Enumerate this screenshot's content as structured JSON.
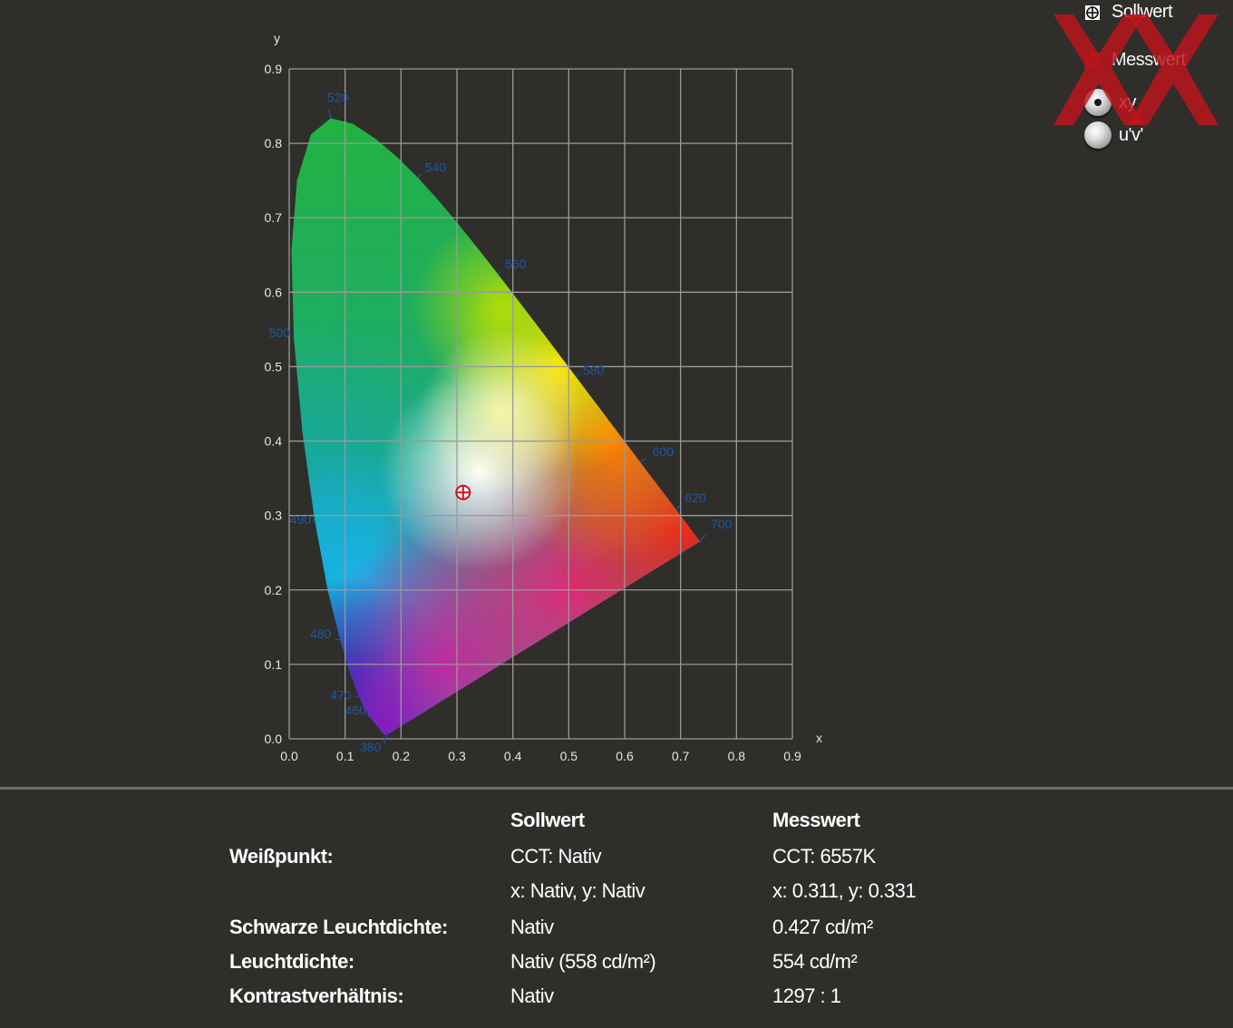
{
  "chart_data": {
    "type": "scatter",
    "title": "",
    "xlabel": "x",
    "ylabel": "y",
    "xlim": [
      0,
      0.9
    ],
    "ylim": [
      0,
      0.9
    ],
    "grid": true,
    "x_ticks": [
      "0.0",
      "0.1",
      "0.2",
      "0.3",
      "0.4",
      "0.5",
      "0.6",
      "0.7",
      "0.8",
      "0.9"
    ],
    "y_ticks": [
      "0.0",
      "0.1",
      "0.2",
      "0.3",
      "0.4",
      "0.5",
      "0.6",
      "0.7",
      "0.8",
      "0.9"
    ],
    "spectral_locus": [
      {
        "nm": "380",
        "x": 0.1741,
        "y": 0.005
      },
      {
        "nm": "460",
        "x": 0.144,
        "y": 0.0297
      },
      {
        "nm": "470",
        "x": 0.1241,
        "y": 0.0578
      },
      {
        "nm": "480",
        "x": 0.0913,
        "y": 0.1327
      },
      {
        "nm": "490",
        "x": 0.0454,
        "y": 0.295
      },
      {
        "nm": "500",
        "x": 0.0082,
        "y": 0.5384
      },
      {
        "nm": "520",
        "x": 0.0743,
        "y": 0.8338
      },
      {
        "nm": "540",
        "x": 0.2296,
        "y": 0.7543
      },
      {
        "nm": "560",
        "x": 0.3731,
        "y": 0.6245
      },
      {
        "nm": "580",
        "x": 0.5125,
        "y": 0.4866
      },
      {
        "nm": "600",
        "x": 0.627,
        "y": 0.3725
      },
      {
        "nm": "620",
        "x": 0.6915,
        "y": 0.3083
      },
      {
        "nm": "700",
        "x": 0.7347,
        "y": 0.2653
      }
    ],
    "measured_point": {
      "x": 0.311,
      "y": 0.331
    }
  },
  "legend": {
    "target_label": "Sollwert",
    "measured_label": "Messwert",
    "radio_xy": "xy",
    "radio_uv": "u'v'"
  },
  "table": {
    "col_target": "Sollwert",
    "col_measured": "Messwert",
    "rows": [
      {
        "label": "Weißpunkt:",
        "target": "CCT: Nativ",
        "measured": "CCT: 6557K"
      },
      {
        "label": "",
        "target": "x: Nativ, y: Nativ",
        "measured": "x: 0.311, y: 0.331"
      },
      {
        "label": "Schwarze Leuchtdichte:",
        "target": "Nativ",
        "measured": "0.427 cd/m²"
      },
      {
        "label": "Leuchtdichte:",
        "target": "Nativ (558 cd/m²)",
        "measured": "554 cd/m²"
      },
      {
        "label": "Kontrastverhältnis:",
        "target": "Nativ",
        "measured": "1297 : 1"
      }
    ]
  },
  "colors": {
    "background": "#2f2e2b",
    "grid": "#8f8f8f",
    "wavelength_label": "#1f56a6",
    "marker": "#d0101a",
    "logo": "#c0141c"
  }
}
